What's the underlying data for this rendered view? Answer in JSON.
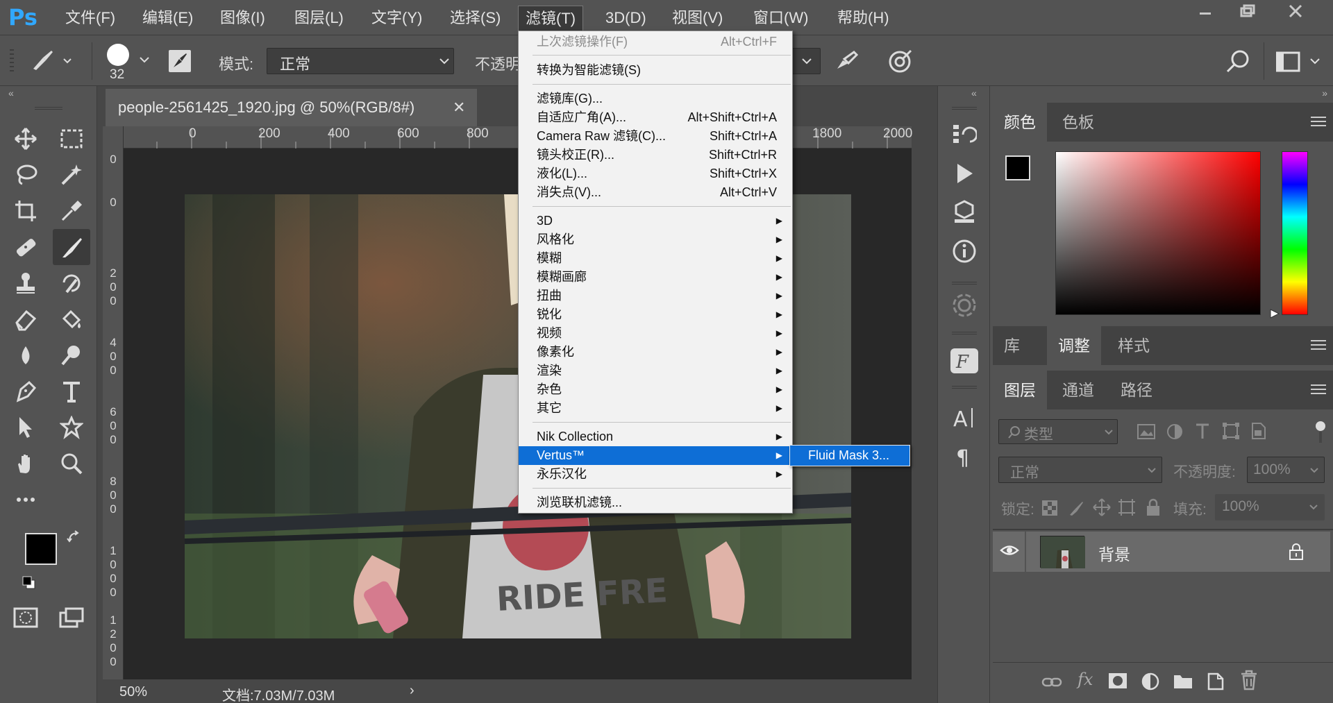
{
  "app": {
    "logo": "Ps"
  },
  "menubar": {
    "items": [
      "文件(F)",
      "编辑(E)",
      "图像(I)",
      "图层(L)",
      "文字(Y)",
      "选择(S)",
      "滤镜(T)",
      "3D(D)",
      "视图(V)",
      "窗口(W)",
      "帮助(H)"
    ],
    "active": "滤镜(T)"
  },
  "options": {
    "brush_size": "32",
    "mode_label": "模式:",
    "mode_value": "正常",
    "opacity_label": "不透明"
  },
  "document": {
    "tab_title": "people-2561425_1920.jpg @ 50%(RGB/8#)",
    "ruler_top": [
      "0",
      "200",
      "400",
      "600",
      "800",
      "1800",
      "2000"
    ],
    "ruler_left": [
      "0",
      "0",
      "2\n0\n0",
      "4\n0\n0",
      "6\n0\n0",
      "8\n0\n0",
      "1\n0\n0\n0",
      "1\n2\n0\n0"
    ],
    "zoom": "50%",
    "doc_size": "文档:7.03M/7.03M"
  },
  "filter_menu": {
    "last_filter": {
      "label": "上次滤镜操作(F)",
      "shortcut": "Alt+Ctrl+F"
    },
    "smart": {
      "label": "转换为智能滤镜(S)"
    },
    "group1": [
      {
        "label": "滤镜库(G)...",
        "shortcut": ""
      },
      {
        "label": "自适应广角(A)...",
        "shortcut": "Alt+Shift+Ctrl+A"
      },
      {
        "label": "Camera Raw 滤镜(C)...",
        "shortcut": "Shift+Ctrl+A"
      },
      {
        "label": "镜头校正(R)...",
        "shortcut": "Shift+Ctrl+R"
      },
      {
        "label": "液化(L)...",
        "shortcut": "Shift+Ctrl+X"
      },
      {
        "label": "消失点(V)...",
        "shortcut": "Alt+Ctrl+V"
      }
    ],
    "group2": [
      "3D",
      "风格化",
      "模糊",
      "模糊画廊",
      "扭曲",
      "锐化",
      "视频",
      "像素化",
      "渲染",
      "杂色",
      "其它"
    ],
    "group3": [
      "Nik Collection",
      "Vertus™",
      "永乐汉化"
    ],
    "browse": "浏览联机滤镜...",
    "highlighted": "Vertus™"
  },
  "submenu": {
    "item": "Fluid Mask 3..."
  },
  "panels": {
    "color_tabs": [
      "颜色",
      "色板"
    ],
    "adjust_tabs": [
      "库",
      "调整",
      "样式"
    ],
    "layer_tabs": [
      "图层",
      "通道",
      "路径"
    ],
    "filter_kind": "类型",
    "blend_mode": "正常",
    "opacity_label": "不透明度:",
    "opacity_value": "100%",
    "lock_label": "锁定:",
    "fill_label": "填充:",
    "fill_value": "100%",
    "layer_name": "背景"
  },
  "colors": {
    "accent": "#0e6ed6",
    "ps_blue": "#31a8ff",
    "bg": "#535353"
  }
}
